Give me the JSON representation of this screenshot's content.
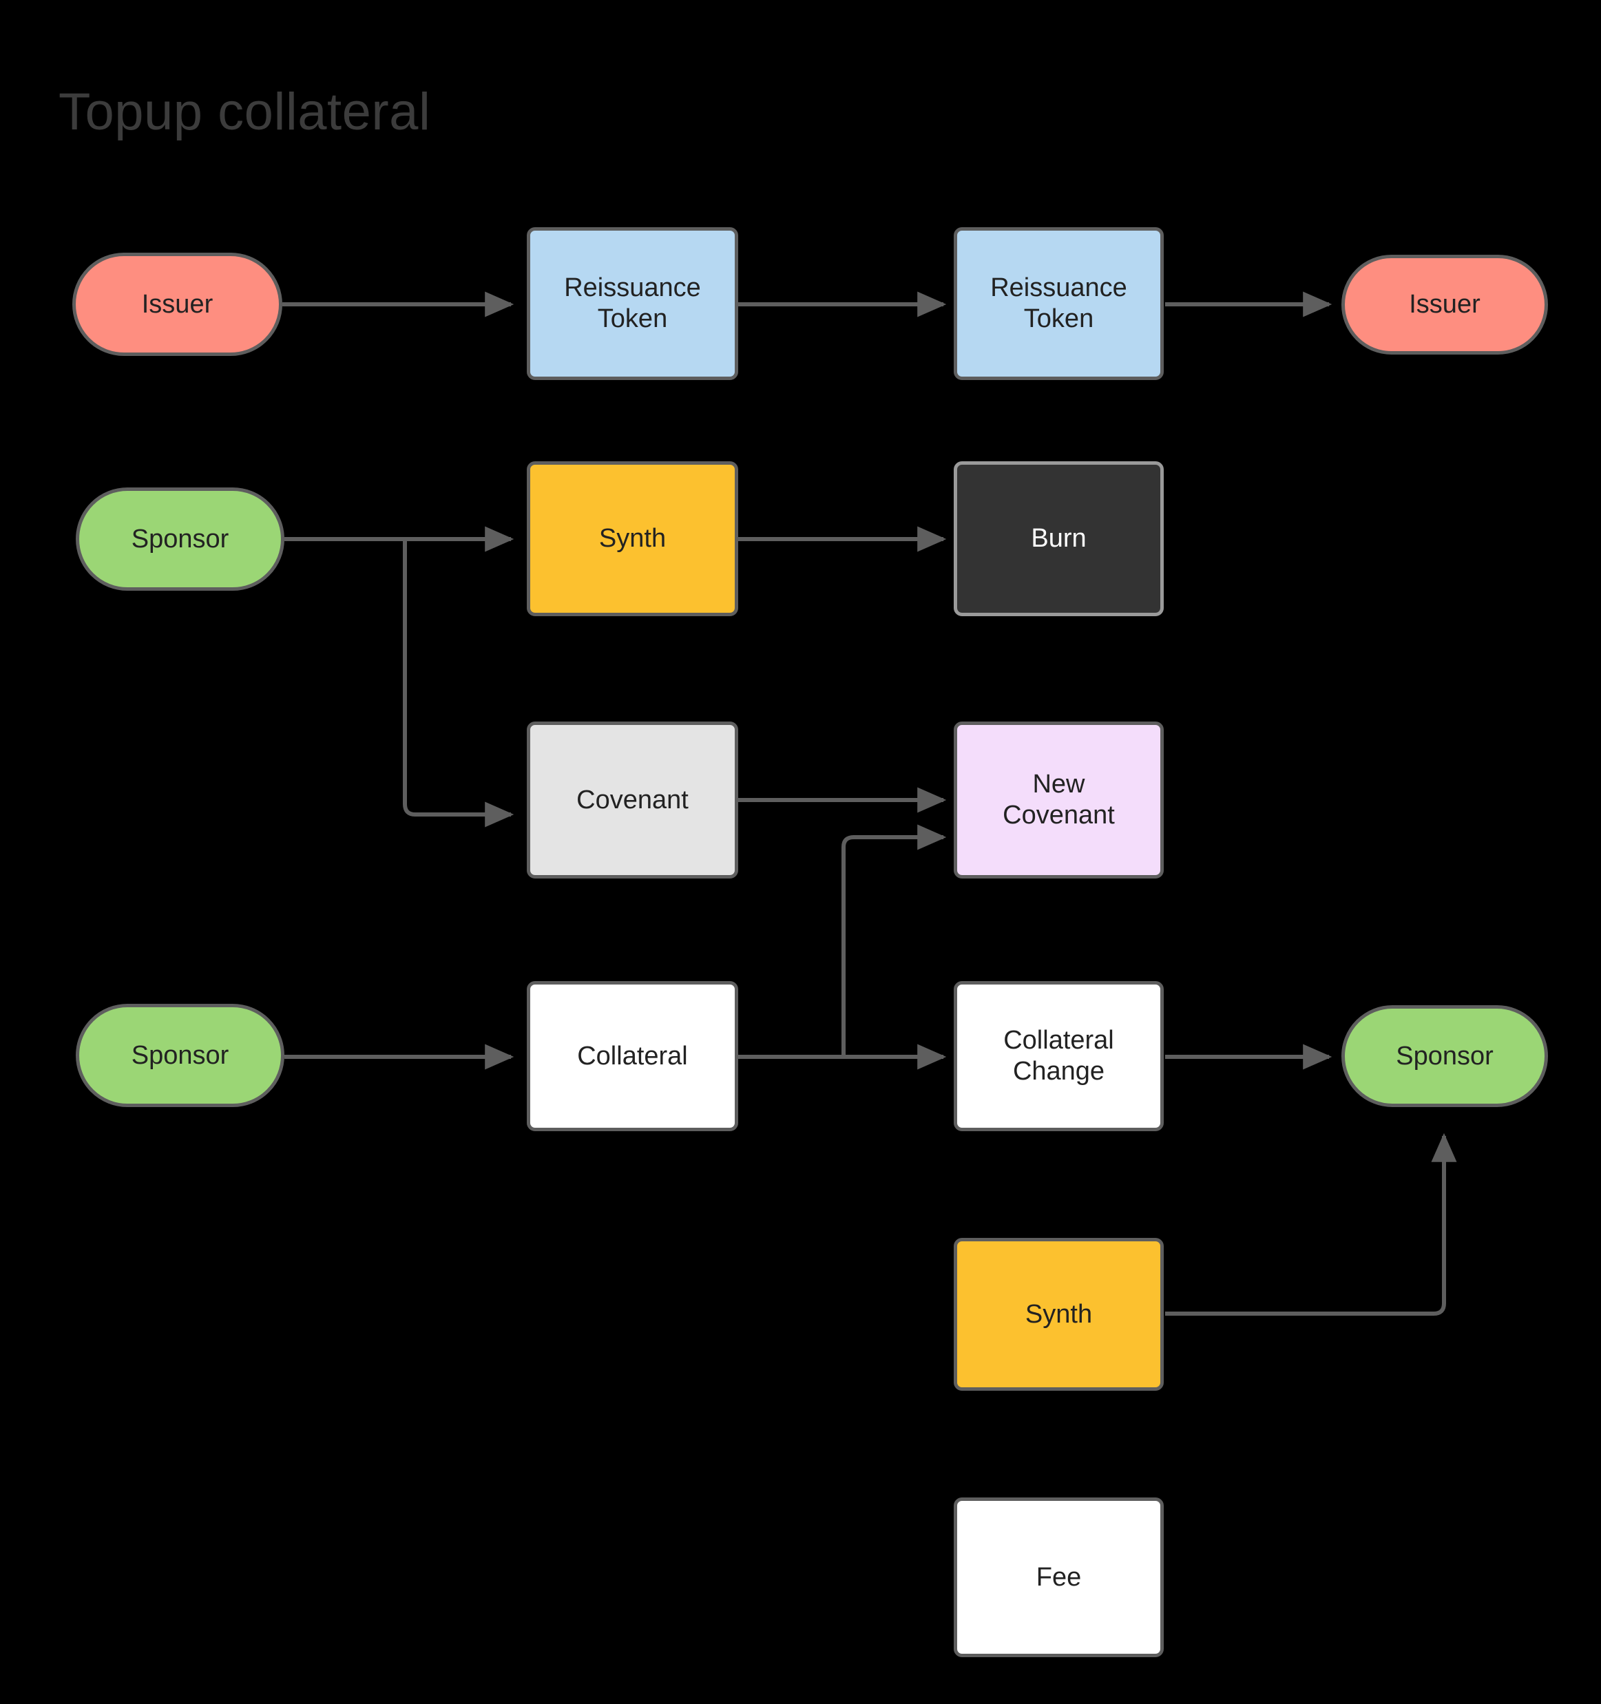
{
  "diagram": {
    "title": "Topup collateral",
    "title_color": "#3c3c3c",
    "background_color": "#000000",
    "edge_color": "#5e5e5e",
    "node_border_color": "#5e5e5e",
    "palette": {
      "issuer": "#fe8e80",
      "reissuance_token": "#b6d8f2",
      "sponsor": "#9bd675",
      "synth": "#fcc12f",
      "burn": "#333333",
      "covenant": "#e4e4e4",
      "new_covenant": "#f4ddfb",
      "white": "#ffffff"
    },
    "nodes": [
      {
        "id": "issuer_in",
        "label": "Issuer",
        "shape": "pill",
        "fill": "issuer"
      },
      {
        "id": "reissuance_in",
        "label": "Reissuance\nToken",
        "shape": "box",
        "fill": "reissuance_token"
      },
      {
        "id": "reissuance_out",
        "label": "Reissuance\nToken",
        "shape": "box",
        "fill": "reissuance_token"
      },
      {
        "id": "issuer_out",
        "label": "Issuer",
        "shape": "pill",
        "fill": "issuer"
      },
      {
        "id": "sponsor_synth",
        "label": "Sponsor",
        "shape": "pill",
        "fill": "sponsor"
      },
      {
        "id": "synth_in",
        "label": "Synth",
        "shape": "box",
        "fill": "synth"
      },
      {
        "id": "burn",
        "label": "Burn",
        "shape": "box",
        "fill": "burn"
      },
      {
        "id": "covenant",
        "label": "Covenant",
        "shape": "box",
        "fill": "covenant"
      },
      {
        "id": "new_covenant",
        "label": "New\nCovenant",
        "shape": "box",
        "fill": "new_covenant"
      },
      {
        "id": "sponsor_coll",
        "label": "Sponsor",
        "shape": "pill",
        "fill": "sponsor"
      },
      {
        "id": "collateral",
        "label": "Collateral",
        "shape": "box",
        "fill": "white"
      },
      {
        "id": "collateral_change",
        "label": "Collateral\nChange",
        "shape": "box",
        "fill": "white"
      },
      {
        "id": "sponsor_out",
        "label": "Sponsor",
        "shape": "pill",
        "fill": "sponsor"
      },
      {
        "id": "synth_out",
        "label": "Synth",
        "shape": "box",
        "fill": "synth"
      },
      {
        "id": "fee",
        "label": "Fee",
        "shape": "box",
        "fill": "white"
      }
    ],
    "edges": [
      {
        "from": "issuer_in",
        "to": "reissuance_in"
      },
      {
        "from": "reissuance_in",
        "to": "reissuance_out"
      },
      {
        "from": "reissuance_out",
        "to": "issuer_out"
      },
      {
        "from": "sponsor_synth",
        "to": "synth_in"
      },
      {
        "from": "sponsor_synth",
        "to": "covenant"
      },
      {
        "from": "synth_in",
        "to": "burn"
      },
      {
        "from": "covenant",
        "to": "new_covenant"
      },
      {
        "from": "sponsor_coll",
        "to": "collateral"
      },
      {
        "from": "collateral",
        "to": "collateral_change"
      },
      {
        "from": "collateral",
        "to": "new_covenant"
      },
      {
        "from": "collateral_change",
        "to": "sponsor_out"
      },
      {
        "from": "synth_out",
        "to": "sponsor_out"
      }
    ]
  }
}
